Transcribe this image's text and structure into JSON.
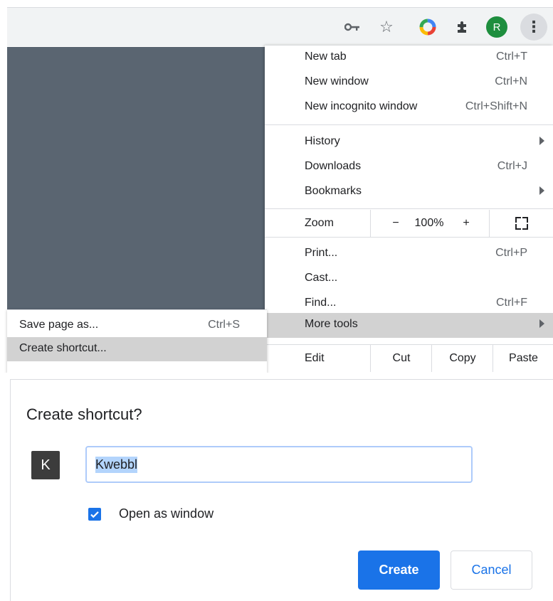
{
  "toolbar": {
    "icons": [
      "key-icon",
      "star-icon",
      "extension-color-icon",
      "puzzle-icon"
    ],
    "avatar_letter": "R",
    "menu_icon": "kebab-icon",
    "avatar_color": "#1e8e3e"
  },
  "menu": {
    "new_tab": {
      "label": "New tab",
      "shortcut": "Ctrl+T"
    },
    "new_window": {
      "label": "New window",
      "shortcut": "Ctrl+N"
    },
    "new_incognito": {
      "label": "New incognito window",
      "shortcut": "Ctrl+Shift+N"
    },
    "history": {
      "label": "History"
    },
    "downloads": {
      "label": "Downloads",
      "shortcut": "Ctrl+J"
    },
    "bookmarks": {
      "label": "Bookmarks"
    },
    "zoom": {
      "label": "Zoom",
      "minus": "−",
      "value": "100%",
      "plus": "+"
    },
    "print": {
      "label": "Print...",
      "shortcut": "Ctrl+P"
    },
    "cast": {
      "label": "Cast..."
    },
    "find": {
      "label": "Find...",
      "shortcut": "Ctrl+F"
    },
    "more_tools": {
      "label": "More tools"
    },
    "edit": {
      "label": "Edit",
      "cut": "Cut",
      "copy": "Copy",
      "paste": "Paste"
    }
  },
  "submenu": {
    "save_page": {
      "label": "Save page as...",
      "shortcut": "Ctrl+S"
    },
    "create_shortcut": {
      "label": "Create shortcut..."
    }
  },
  "dialog": {
    "title": "Create shortcut?",
    "icon_letter": "K",
    "name_value": "Kwebbl",
    "open_as_window_checked": true,
    "open_as_window_label": "Open as window",
    "create_label": "Create",
    "cancel_label": "Cancel",
    "accent": "#1a73e8"
  }
}
